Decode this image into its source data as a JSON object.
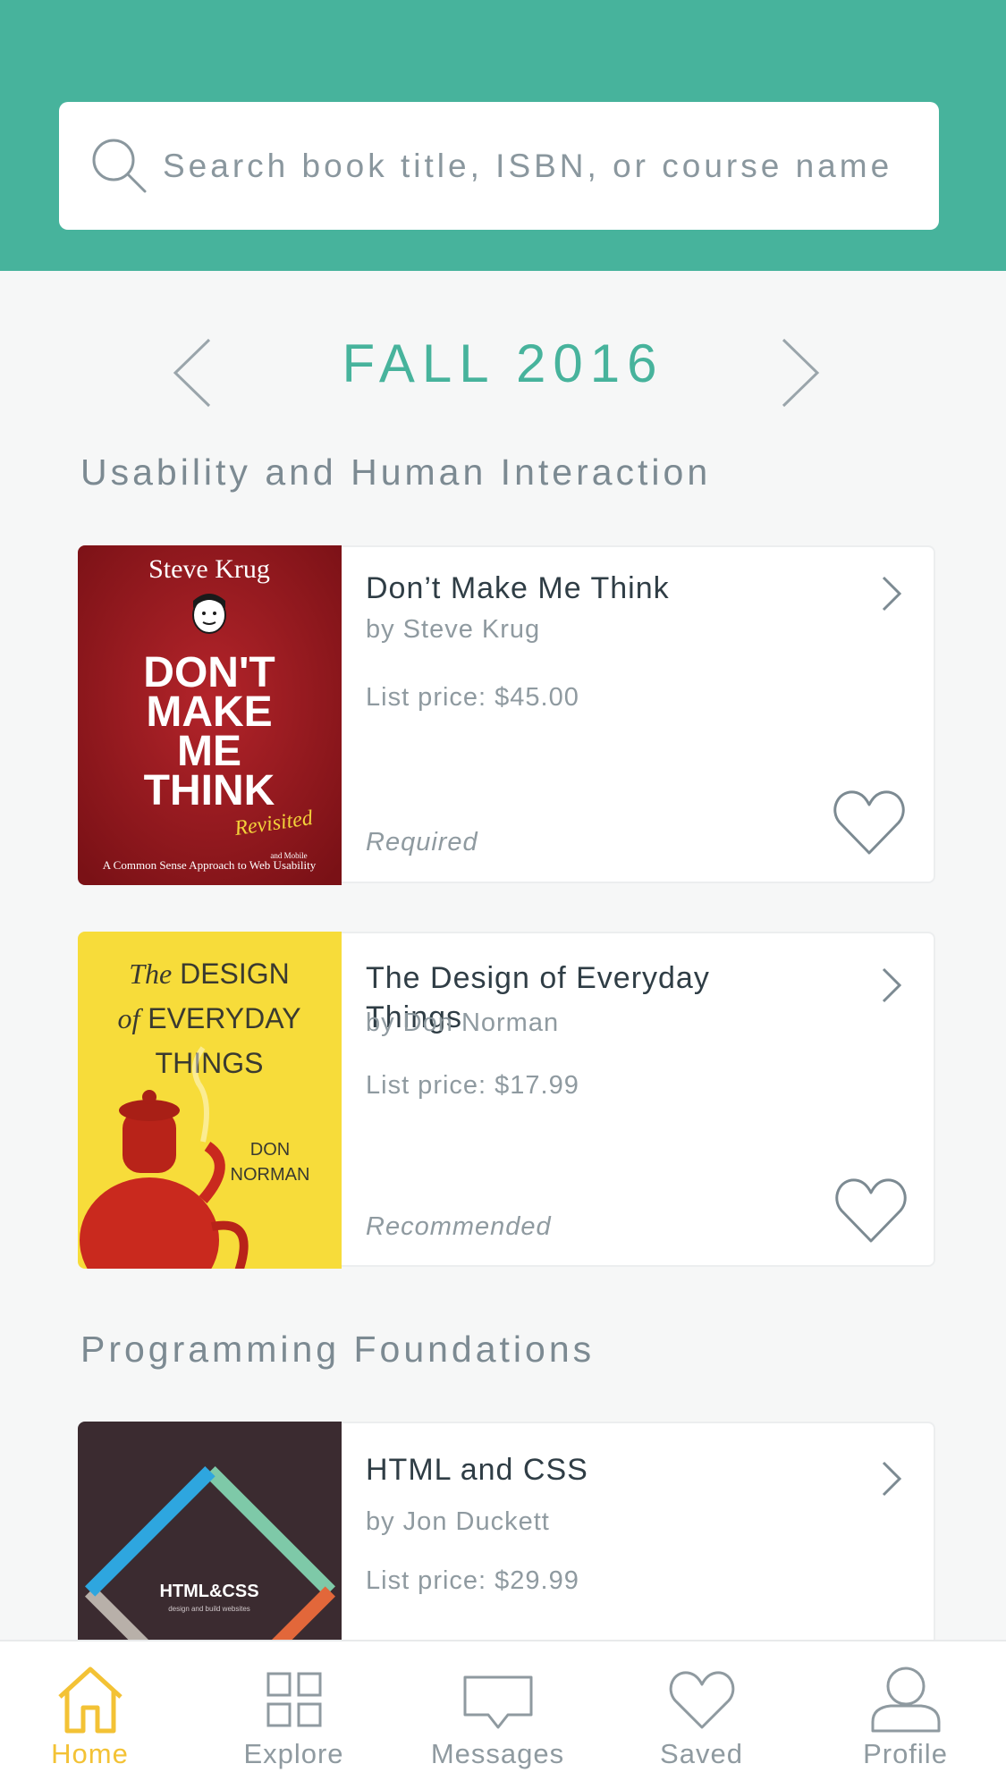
{
  "search": {
    "placeholder": "Search book title, ISBN, or course name"
  },
  "term": {
    "title": "FALL 2016"
  },
  "sections": [
    {
      "title": "Usability and Human Interaction",
      "books": [
        {
          "title": "Don’t Make Me Think",
          "author": "by Steve Krug",
          "price": "List price: $45.00",
          "requirement": "Required",
          "cover": {
            "author": "Steve Krug",
            "line1": "DON'T",
            "line2": "MAKE",
            "line3": "ME",
            "line4": "THINK",
            "accent": "Revisited",
            "subtitle": "A Common Sense Approach to Web Usability",
            "subtitle_extra": "and Mobile"
          }
        },
        {
          "title": "The Design of Everyday Things",
          "author": "by Don Norman",
          "price": "List price: $17.99",
          "requirement": "Recommended",
          "cover": {
            "line1_italic": "The",
            "line1": "DESIGN",
            "line2_italic": "of",
            "line2": "EVERYDAY",
            "line3": "THINGS",
            "author_first": "DON",
            "author_last": "NORMAN"
          }
        }
      ]
    },
    {
      "title": "Programming Foundations",
      "books": [
        {
          "title": "HTML and CSS",
          "author": "by Jon Duckett",
          "price": "List price: $29.99",
          "cover": {
            "title": "HTML&CSS",
            "subtitle": "design and build websites"
          }
        }
      ]
    }
  ],
  "tabs": [
    {
      "label": "Home",
      "icon": "home-icon",
      "active": true
    },
    {
      "label": "Explore",
      "icon": "grid-icon",
      "active": false
    },
    {
      "label": "Messages",
      "icon": "chat-bubble-icon",
      "active": false
    },
    {
      "label": "Saved",
      "icon": "heart-icon",
      "active": false
    },
    {
      "label": "Profile",
      "icon": "user-icon",
      "active": false
    }
  ],
  "colors": {
    "brand_teal": "#47b39c",
    "active_tab": "#f3c235",
    "muted_text": "#8f9aa0",
    "dark_text": "#2f3d45"
  }
}
